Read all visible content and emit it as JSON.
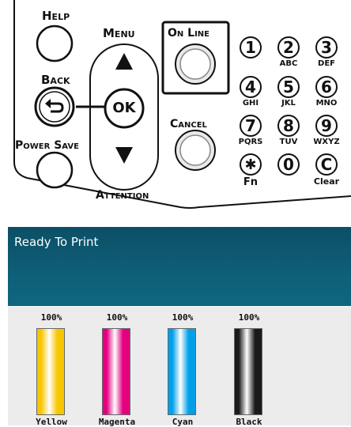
{
  "panel": {
    "help_label": "Help",
    "menu_label": "Menu",
    "online_label": "On Line",
    "back_label": "Back",
    "ok_label": "OK",
    "cancel_label": "Cancel",
    "power_save_label": "Power Save",
    "attention_label": "Attention",
    "keypad": [
      {
        "digit": "1",
        "letters": ""
      },
      {
        "digit": "2",
        "letters": "ABC"
      },
      {
        "digit": "3",
        "letters": "DEF"
      },
      {
        "digit": "4",
        "letters": "GHI"
      },
      {
        "digit": "5",
        "letters": "JKL"
      },
      {
        "digit": "6",
        "letters": "MNO"
      },
      {
        "digit": "7",
        "letters": "PQRS"
      },
      {
        "digit": "8",
        "letters": "TUV"
      },
      {
        "digit": "9",
        "letters": "WXYZ"
      },
      {
        "digit": "✱",
        "letters": "Fn"
      },
      {
        "digit": "0",
        "letters": ""
      },
      {
        "digit": "C",
        "letters": "Clear"
      }
    ]
  },
  "screen": {
    "status_text": "Ready To Print",
    "toners": [
      {
        "name": "Yellow",
        "level_text": "100%",
        "level": 1.0,
        "color": "#f7c600"
      },
      {
        "name": "Magenta",
        "level_text": "100%",
        "level": 1.0,
        "color": "#e4007f"
      },
      {
        "name": "Cyan",
        "level_text": "100%",
        "level": 1.0,
        "color": "#00a0e9"
      },
      {
        "name": "Black",
        "level_text": "100%",
        "level": 1.0,
        "color": "#1a1a1a"
      }
    ]
  }
}
